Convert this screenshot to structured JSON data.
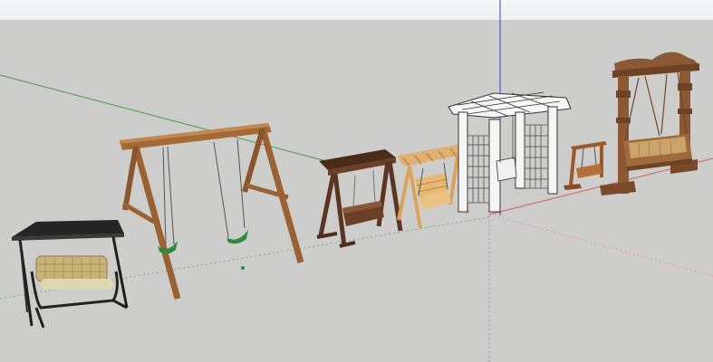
{
  "viewport": {
    "background": "#cdcdcb",
    "sky_color": "#f2f3f5",
    "axis_colors": {
      "red": "#d45a5a",
      "green": "#4a9a4a",
      "blue": "#3b3bd6"
    }
  },
  "models": [
    {
      "name": "canopy-patio-swing",
      "kind": "canopy swing with cushions",
      "color": "#2b2b2b"
    },
    {
      "name": "a-frame-swing-set",
      "kind": "wooden swing set with two green seats",
      "color": "#a36a36"
    },
    {
      "name": "dark-wood-bench-swing",
      "kind": "dark wood roofed bench swing",
      "color": "#5a3622"
    },
    {
      "name": "light-wood-frame-swing",
      "kind": "pine frame swing",
      "color": "#d9a460"
    },
    {
      "name": "white-pergola-swing",
      "kind": "white pergola with lattice and hanging bench",
      "color": "#f5f5f5"
    },
    {
      "name": "small-wooden-swing",
      "kind": "small wooden rocker swing",
      "color": "#9a5a2a"
    },
    {
      "name": "carved-wood-jhula",
      "kind": "ornate carved wooden swing",
      "color": "#8b5a34"
    }
  ]
}
